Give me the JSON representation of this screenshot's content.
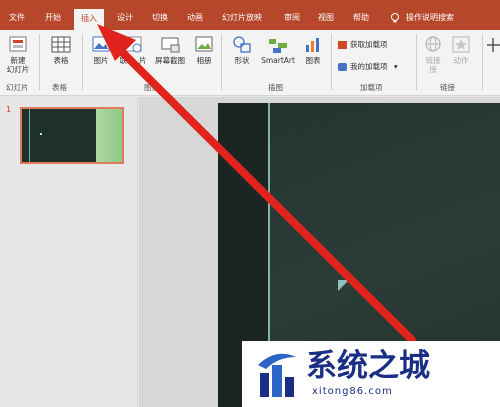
{
  "tabs": [
    "文件",
    "开始",
    "插入",
    "设计",
    "切换",
    "动画",
    "幻灯片放映",
    "审阅",
    "视图",
    "帮助"
  ],
  "tell_me": "操作说明搜索",
  "ribbon": {
    "new_slide": [
      "新建",
      "幻灯片"
    ],
    "table": "表格",
    "picture": "图片",
    "online_picture_partial": "联",
    "picture_partial_right": "片",
    "screenshot": "屏幕截图",
    "album": "相册",
    "shapes": "形状",
    "smartart": "SmartArt",
    "chart": "图表",
    "get_addins": "获取加载项",
    "my_addins": "我的加载项",
    "link": "链接",
    "link_partial": "接",
    "action": "动作"
  },
  "groups": {
    "slides": "幻灯片",
    "tables": "表格",
    "images": "图像",
    "illustrations": "插图",
    "addins": "加载项",
    "links": "链接"
  },
  "slide_number": "1",
  "watermark": {
    "title": "系统之城",
    "url": "xitong86.com"
  },
  "colors": {
    "accent": "#b7472a",
    "slide_bg": "#24332f",
    "arrow": "#e0231d",
    "watermark": "#1a2e86"
  }
}
